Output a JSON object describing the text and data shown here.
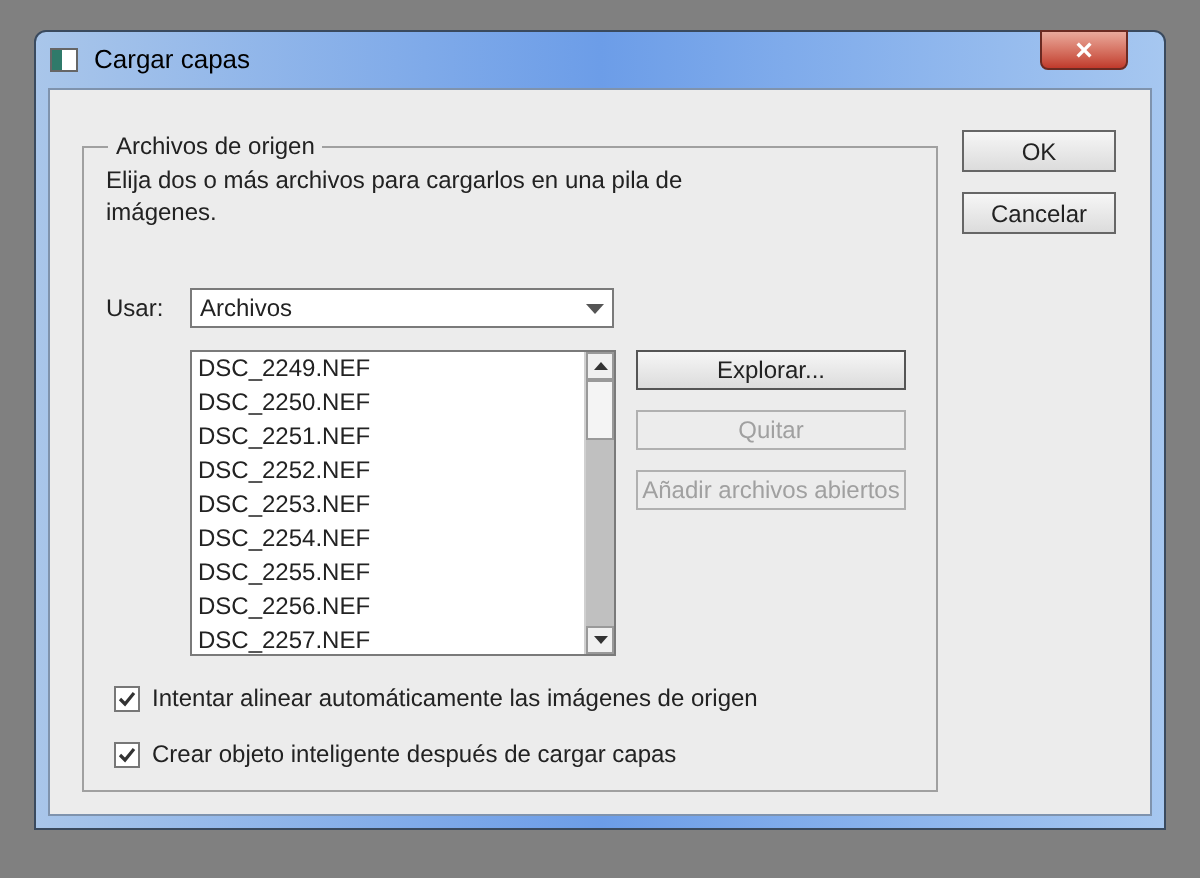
{
  "window": {
    "title": "Cargar capas",
    "close": "×"
  },
  "group": {
    "title": "Archivos de origen",
    "description": "Elija dos o más archivos para cargarlos en una pila de imágenes."
  },
  "use": {
    "label": "Usar:",
    "value": "Archivos"
  },
  "files": [
    "DSC_2249.NEF",
    "DSC_2250.NEF",
    "DSC_2251.NEF",
    "DSC_2252.NEF",
    "DSC_2253.NEF",
    "DSC_2254.NEF",
    "DSC_2255.NEF",
    "DSC_2256.NEF",
    "DSC_2257.NEF"
  ],
  "list_buttons": [
    {
      "label": "Explorar...",
      "disabled": false
    },
    {
      "label": "Quitar",
      "disabled": true
    },
    {
      "label": "Añadir archivos abiertos",
      "disabled": true
    }
  ],
  "options": [
    {
      "label": "Intentar alinear automáticamente las imágenes de origen",
      "checked": true
    },
    {
      "label": "Crear objeto inteligente después de cargar capas",
      "checked": true
    }
  ],
  "buttons": [
    "OK",
    "Cancelar"
  ]
}
